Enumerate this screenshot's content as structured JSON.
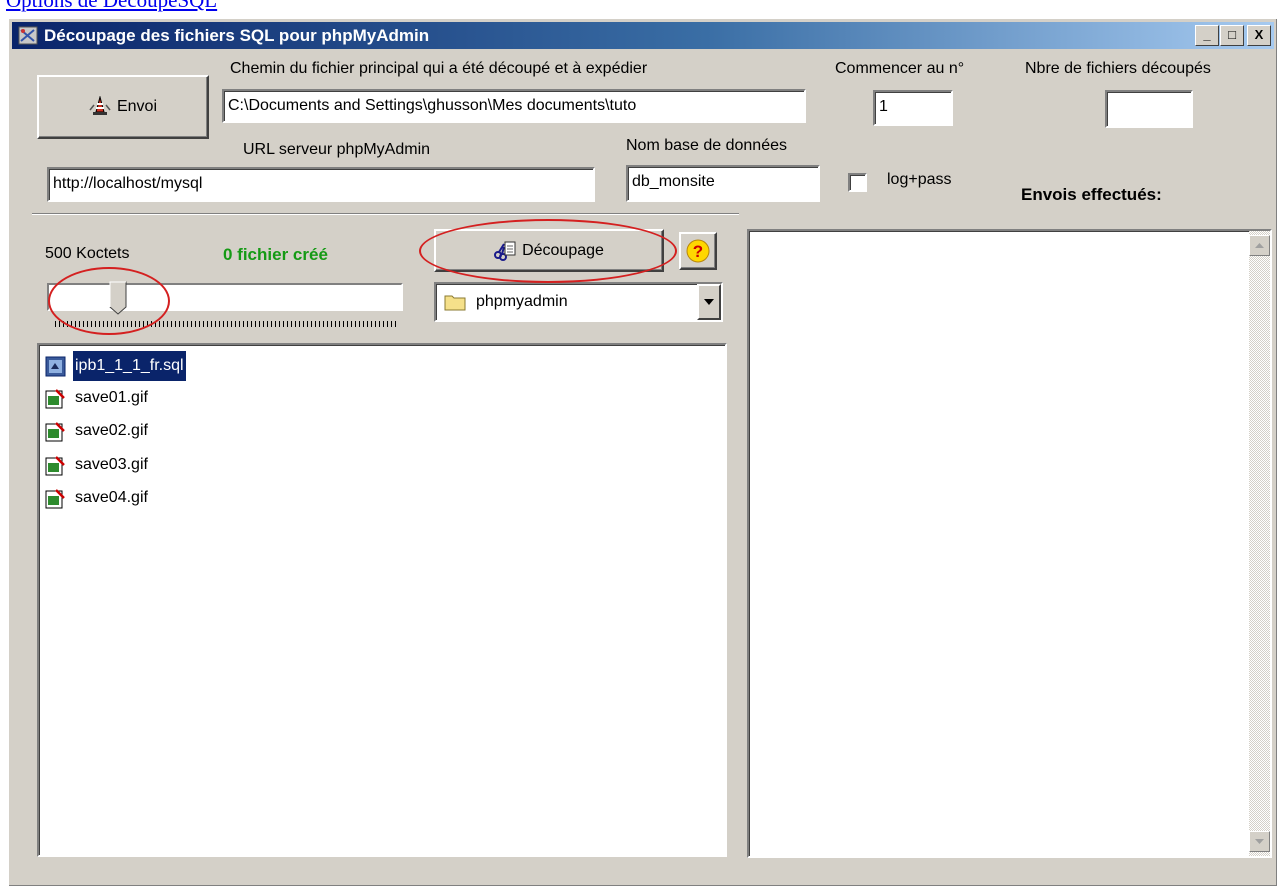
{
  "page": {
    "link_text": "Options de DécoupeSQL"
  },
  "window": {
    "title": "Découpage des fichiers SQL pour phpMyAdmin",
    "controls": {
      "minimize": "_",
      "maximize": "□",
      "close": "X"
    }
  },
  "send_button": {
    "label": "Envoi",
    "icon": "traffic-cone-icon"
  },
  "main_file": {
    "label": "Chemin du fichier principal qui a été découpé et à expédier",
    "value": "C:\\Documents and Settings\\ghusson\\Mes documents\\tuto"
  },
  "start_at": {
    "label": "Commencer au n°",
    "value": "1"
  },
  "file_count": {
    "label": "Nbre de fichiers découpés",
    "value": ""
  },
  "server_url": {
    "label": "URL serveur phpMyAdmin",
    "value": "http://localhost/mysql"
  },
  "database": {
    "label": "Nom base de données",
    "value": "db_monsite"
  },
  "logpass": {
    "label": "log+pass",
    "checked": false
  },
  "sent_label": "Envois effectués:",
  "size": {
    "label": "500 Koctets",
    "slider_fraction": 0.2
  },
  "files_created": {
    "text": "0 fichier créé",
    "color": "#159a15"
  },
  "split_button": {
    "label": "Découpage",
    "icon": "scissors-document-icon"
  },
  "help_button": {
    "label": "?"
  },
  "folder_select": {
    "value": "phpmyadmin",
    "icon": "folder-icon"
  },
  "files": [
    {
      "name": "ipb1_1_1_fr.sql",
      "icon": "sql-file-icon",
      "selected": true
    },
    {
      "name": "save01.gif",
      "icon": "gif-file-icon",
      "selected": false
    },
    {
      "name": "save02.gif",
      "icon": "gif-file-icon",
      "selected": false
    },
    {
      "name": "save03.gif",
      "icon": "gif-file-icon",
      "selected": false
    },
    {
      "name": "save04.gif",
      "icon": "gif-file-icon",
      "selected": false
    }
  ],
  "annotation_color": "#d42020"
}
